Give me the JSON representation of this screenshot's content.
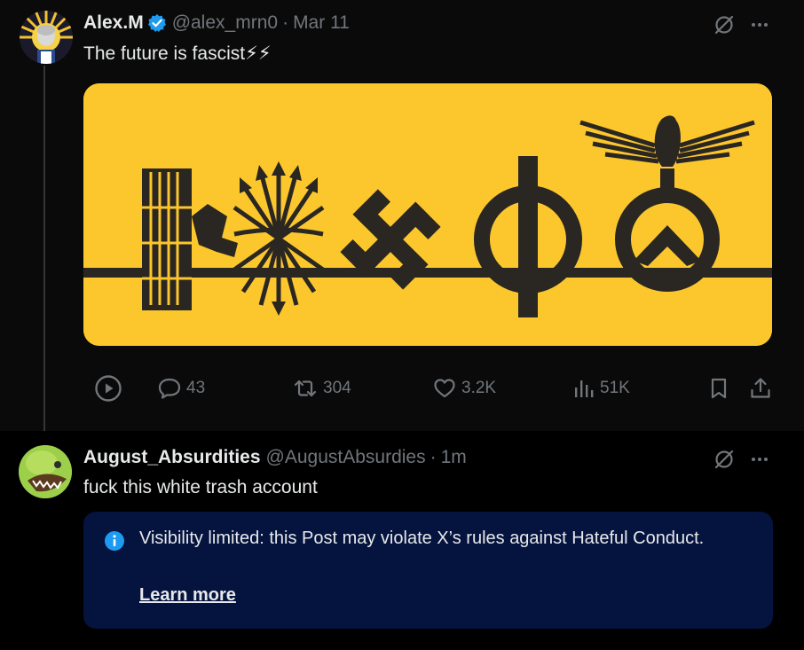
{
  "post1": {
    "name": "Alex.M",
    "handle": "@alex_mrn0",
    "separator": "·",
    "time": "Mar 11",
    "text": "The future is fascist⚡⚡",
    "actions": {
      "replies": "43",
      "reposts": "304",
      "likes": "3.2K",
      "views": "51K"
    }
  },
  "post2": {
    "name": "August_Absurdities",
    "handle": "@AugustAbsurdies",
    "separator": "·",
    "time": "1m",
    "text": "fuck this white trash account",
    "notice": {
      "text": "Visibility limited: this Post may violate X’s rules against Hateful Conduct.",
      "link": "Learn more"
    }
  },
  "colors": {
    "background": "#000000",
    "post_background": "#0a0a0a",
    "text": "#e7e9ea",
    "muted": "#71767b",
    "verified": "#1d9bf0",
    "notice_background": "#05133f",
    "media_background": "#fcc72d"
  },
  "icons": {
    "verified": "verified-badge-icon",
    "grok": "grok-icon",
    "more": "more-icon",
    "play": "play-icon",
    "reply": "reply-icon",
    "repost": "repost-icon",
    "like": "heart-icon",
    "views": "views-icon",
    "bookmark": "bookmark-icon",
    "share": "share-icon",
    "info": "info-icon"
  }
}
